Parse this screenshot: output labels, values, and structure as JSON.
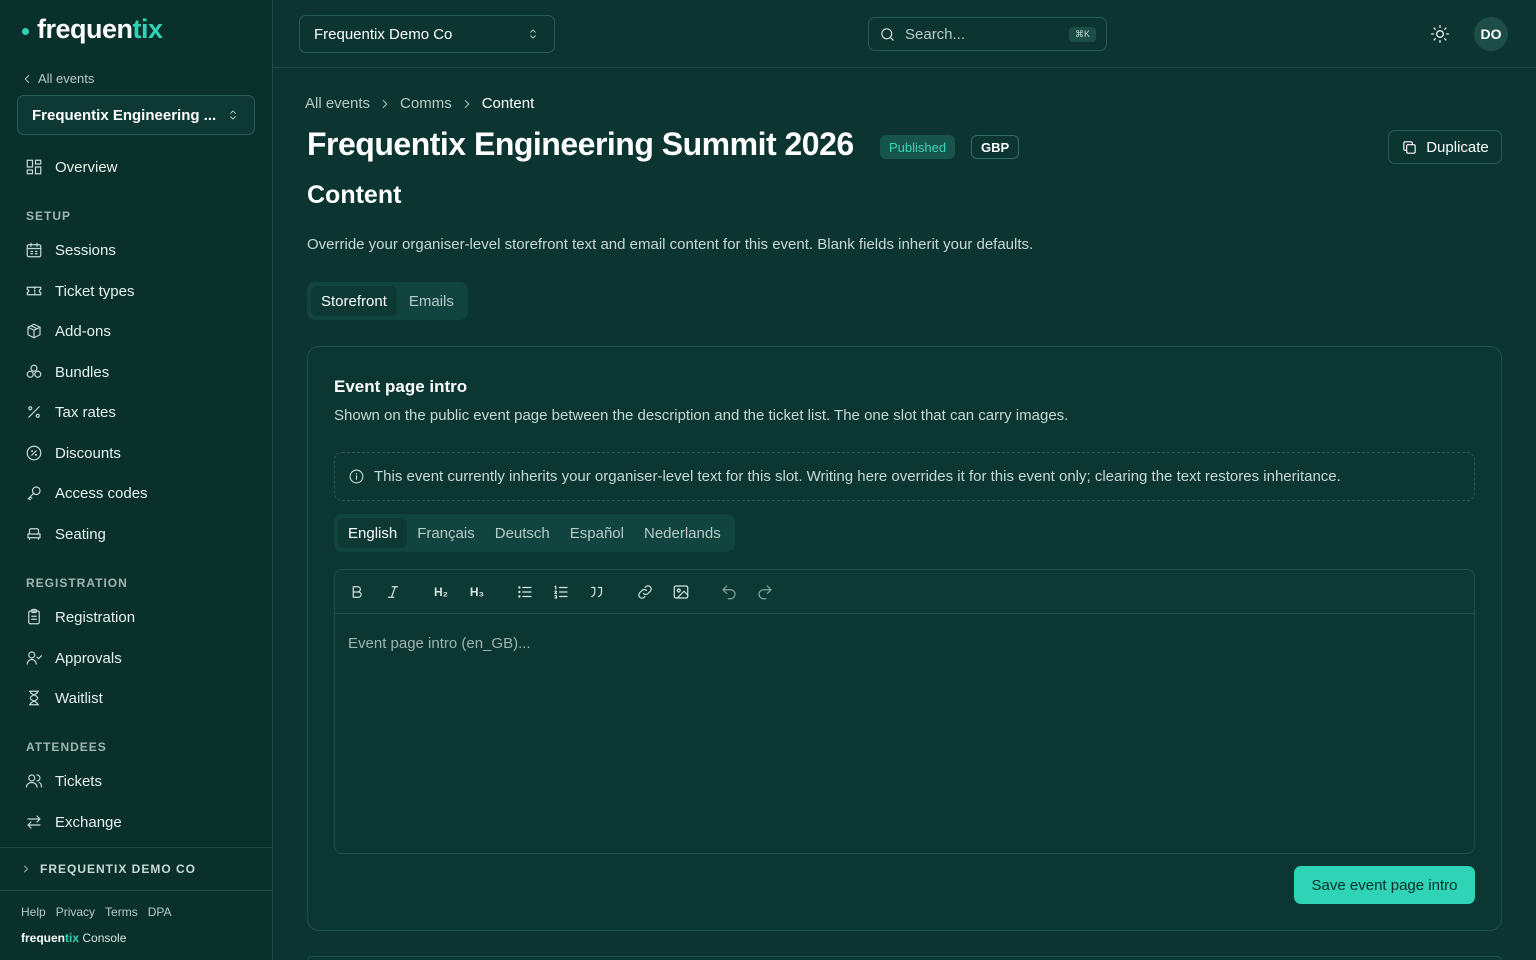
{
  "brand": {
    "name_main": "frequen",
    "name_accent": "tix"
  },
  "sidebar": {
    "back_label": "All events",
    "event_selector": "Frequentix Engineering ...",
    "overview": {
      "label": "Overview",
      "icon": "layout-grid-icon"
    },
    "sections": [
      {
        "title": "SETUP",
        "items": [
          {
            "label": "Sessions",
            "icon": "calendar-icon"
          },
          {
            "label": "Ticket types",
            "icon": "ticket-icon"
          },
          {
            "label": "Add-ons",
            "icon": "package-icon"
          },
          {
            "label": "Bundles",
            "icon": "bundles-icon"
          },
          {
            "label": "Tax rates",
            "icon": "percent-icon"
          },
          {
            "label": "Discounts",
            "icon": "discount-badge-icon"
          },
          {
            "label": "Access codes",
            "icon": "key-icon"
          },
          {
            "label": "Seating",
            "icon": "armchair-icon"
          }
        ]
      },
      {
        "title": "REGISTRATION",
        "items": [
          {
            "label": "Registration",
            "icon": "clipboard-icon"
          },
          {
            "label": "Approvals",
            "icon": "user-check-icon"
          },
          {
            "label": "Waitlist",
            "icon": "hourglass-icon"
          }
        ]
      },
      {
        "title": "ATTENDEES",
        "items": [
          {
            "label": "Tickets",
            "icon": "users-icon"
          },
          {
            "label": "Exchange",
            "icon": "arrows-exchange-icon"
          }
        ]
      }
    ],
    "org_label": "FREQUENTIX DEMO CO",
    "footer_links": [
      "Help",
      "Privacy",
      "Terms",
      "DPA"
    ],
    "footer_brand": {
      "main": "frequen",
      "accent": "tix",
      "suffix": " Console"
    }
  },
  "topbar": {
    "org_name": "Frequentix Demo Co",
    "search_placeholder": "Search...",
    "search_shortcut": "⌘K",
    "avatar_initials": "DO"
  },
  "breadcrumb": [
    "All events",
    "Comms",
    "Content"
  ],
  "page": {
    "title": "Frequentix Engineering Summit 2026",
    "status": "Published",
    "currency": "GBP",
    "duplicate_label": "Duplicate",
    "section_title": "Content",
    "section_desc": "Override your organiser-level storefront text and email content for this event. Blank fields inherit your defaults.",
    "tabs": [
      "Storefront",
      "Emails"
    ],
    "active_tab": "Storefront"
  },
  "card": {
    "title": "Event page intro",
    "desc": "Shown on the public event page between the description and the ticket list. The one slot that can carry images.",
    "notice": "This event currently inherits your organiser-level text for this slot. Writing here overrides it for this event only; clearing the text restores inheritance.",
    "languages": [
      "English",
      "Français",
      "Deutsch",
      "Español",
      "Nederlands"
    ],
    "active_language": "English",
    "toolbar": {
      "h2": "H₂",
      "h3": "H₃"
    },
    "editor_placeholder": "Event page intro (en_GB)...",
    "save_label": "Save event page intro"
  },
  "colors": {
    "accent": "#2fd3b6",
    "background": "#0c3531",
    "sidebar": "#0a302c"
  }
}
